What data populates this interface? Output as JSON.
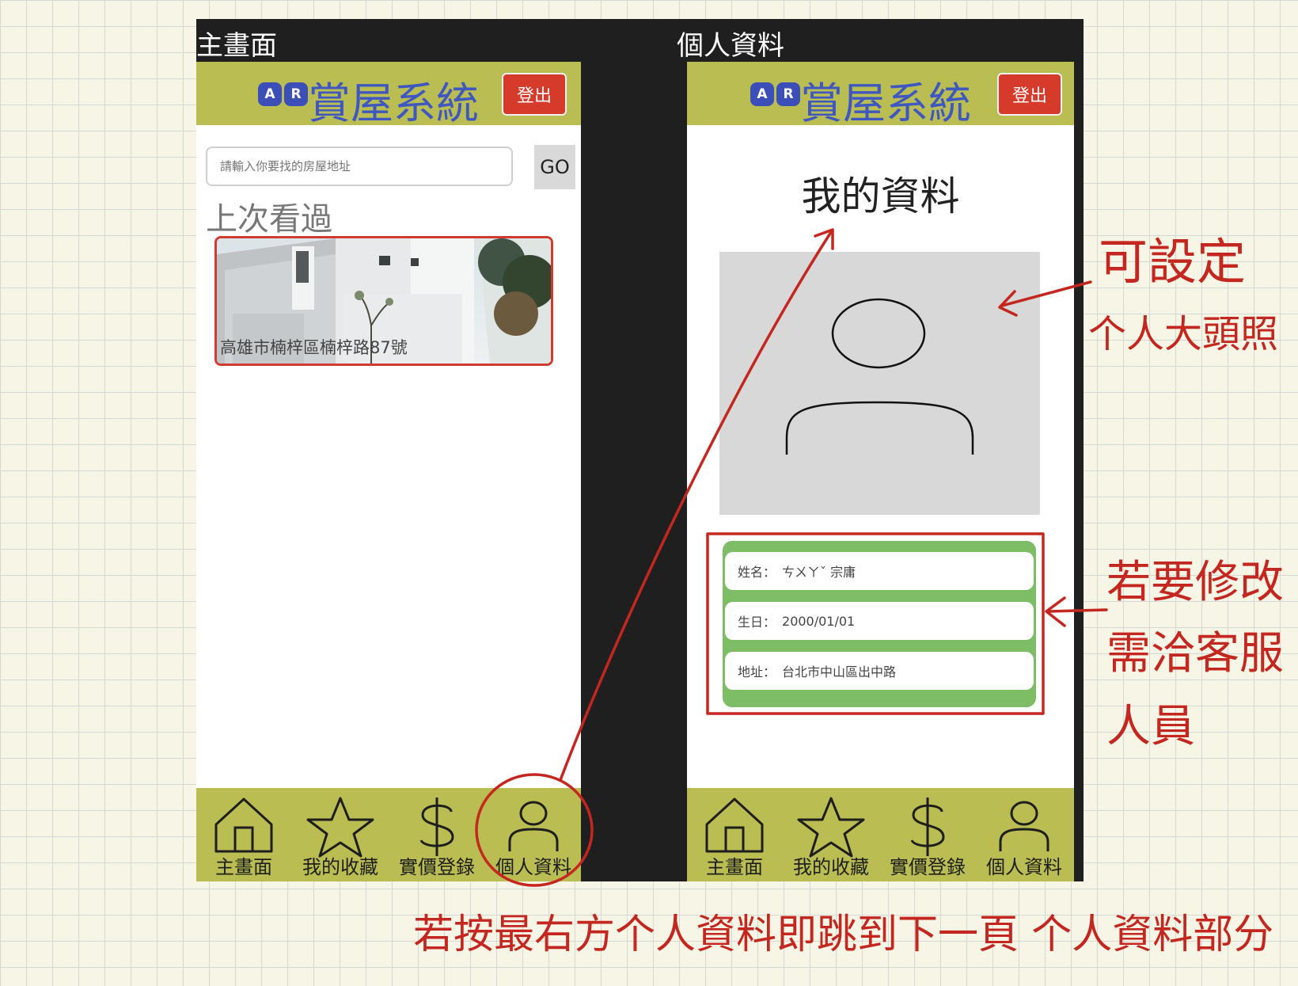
{
  "screens": {
    "home_label": "主畫面",
    "profile_label": "個人資料"
  },
  "header": {
    "logo_a": "A",
    "logo_r": "R",
    "title": "賞屋系統",
    "logout": "登出"
  },
  "home": {
    "search_placeholder": "請輸入你要找的房屋地址",
    "go": "GO",
    "recent_title": "上次看過",
    "recent_address": "高雄市楠梓區楠梓路87號"
  },
  "profile": {
    "title": "我的資料",
    "fields": [
      {
        "label": "姓名：",
        "value": "ㄘㄨㄚˇ 宗庸"
      },
      {
        "label": "生日：",
        "value": "2000/01/01"
      },
      {
        "label": "地址：",
        "value": "台北市中山區出中路"
      }
    ]
  },
  "tabbar": {
    "items": [
      {
        "label": "主畫面",
        "icon": "home-icon"
      },
      {
        "label": "我的收藏",
        "icon": "star-icon"
      },
      {
        "label": "實價登錄",
        "icon": "dollar-icon"
      },
      {
        "label": "個人資料",
        "icon": "person-icon"
      }
    ]
  },
  "annotations": {
    "avatar_note_1": "可設定",
    "avatar_note_2": "个人大頭照",
    "edit_note_1": "若要修改",
    "edit_note_2": "需洽客服",
    "edit_note_3": "人員",
    "bottom_note": "若按最右方个人資料即跳到下一頁 个人資料部分"
  },
  "colors": {
    "header_bg": "#b9bd52",
    "title_blue": "#3f57c0",
    "logout_red": "#d53a2a",
    "panel_green": "#7cbd65",
    "annotation_red": "#c4271f"
  }
}
